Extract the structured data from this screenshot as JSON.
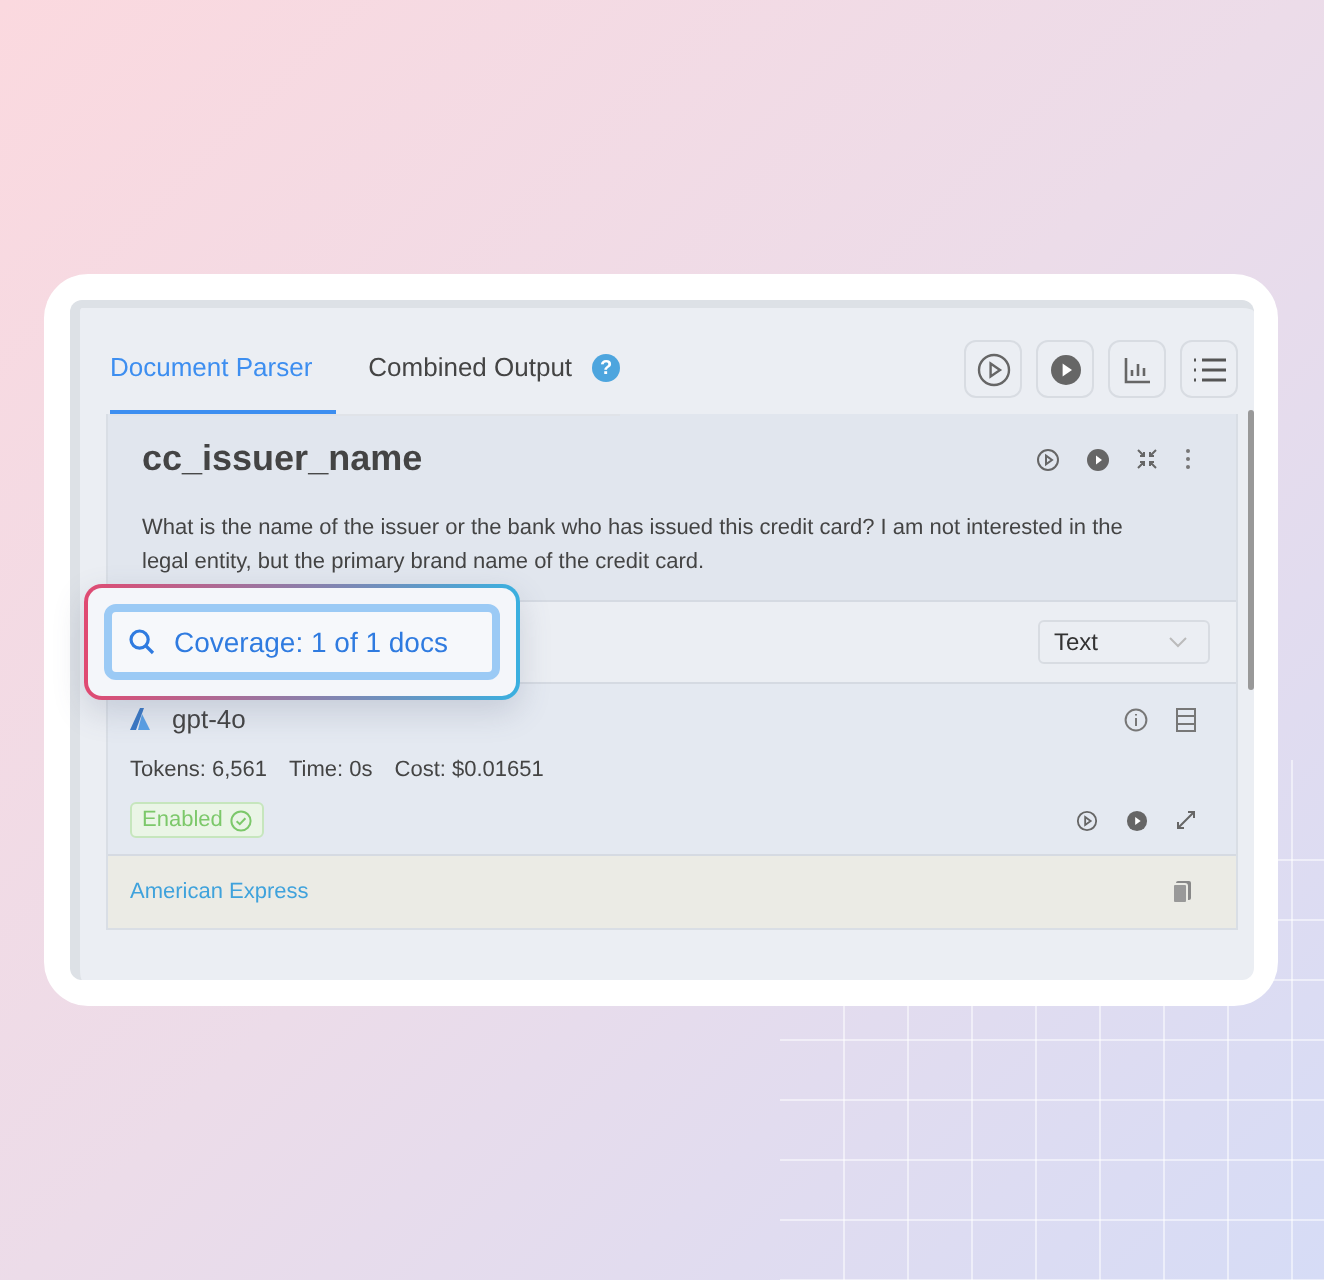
{
  "tabs": [
    {
      "label": "Document Parser",
      "selected": true
    },
    {
      "label": "Combined Output",
      "selected": false,
      "help": "?"
    }
  ],
  "prompt": {
    "title": "cc_issuer_name",
    "description": "What is the name of the issuer or the bank who has issued this credit card? I am not interested in the legal entity, but the primary brand name of the credit card."
  },
  "coverage": {
    "label": "Coverage: 1 of 1 docs"
  },
  "output_type": {
    "value": "Text"
  },
  "model": {
    "name": "gpt-4o",
    "stats": [
      "Tokens: 6,561",
      "Time: 0s",
      "Cost: $0.01651"
    ],
    "status": {
      "label": "Enabled",
      "enabled": true
    }
  },
  "result": {
    "value": "American Express"
  }
}
